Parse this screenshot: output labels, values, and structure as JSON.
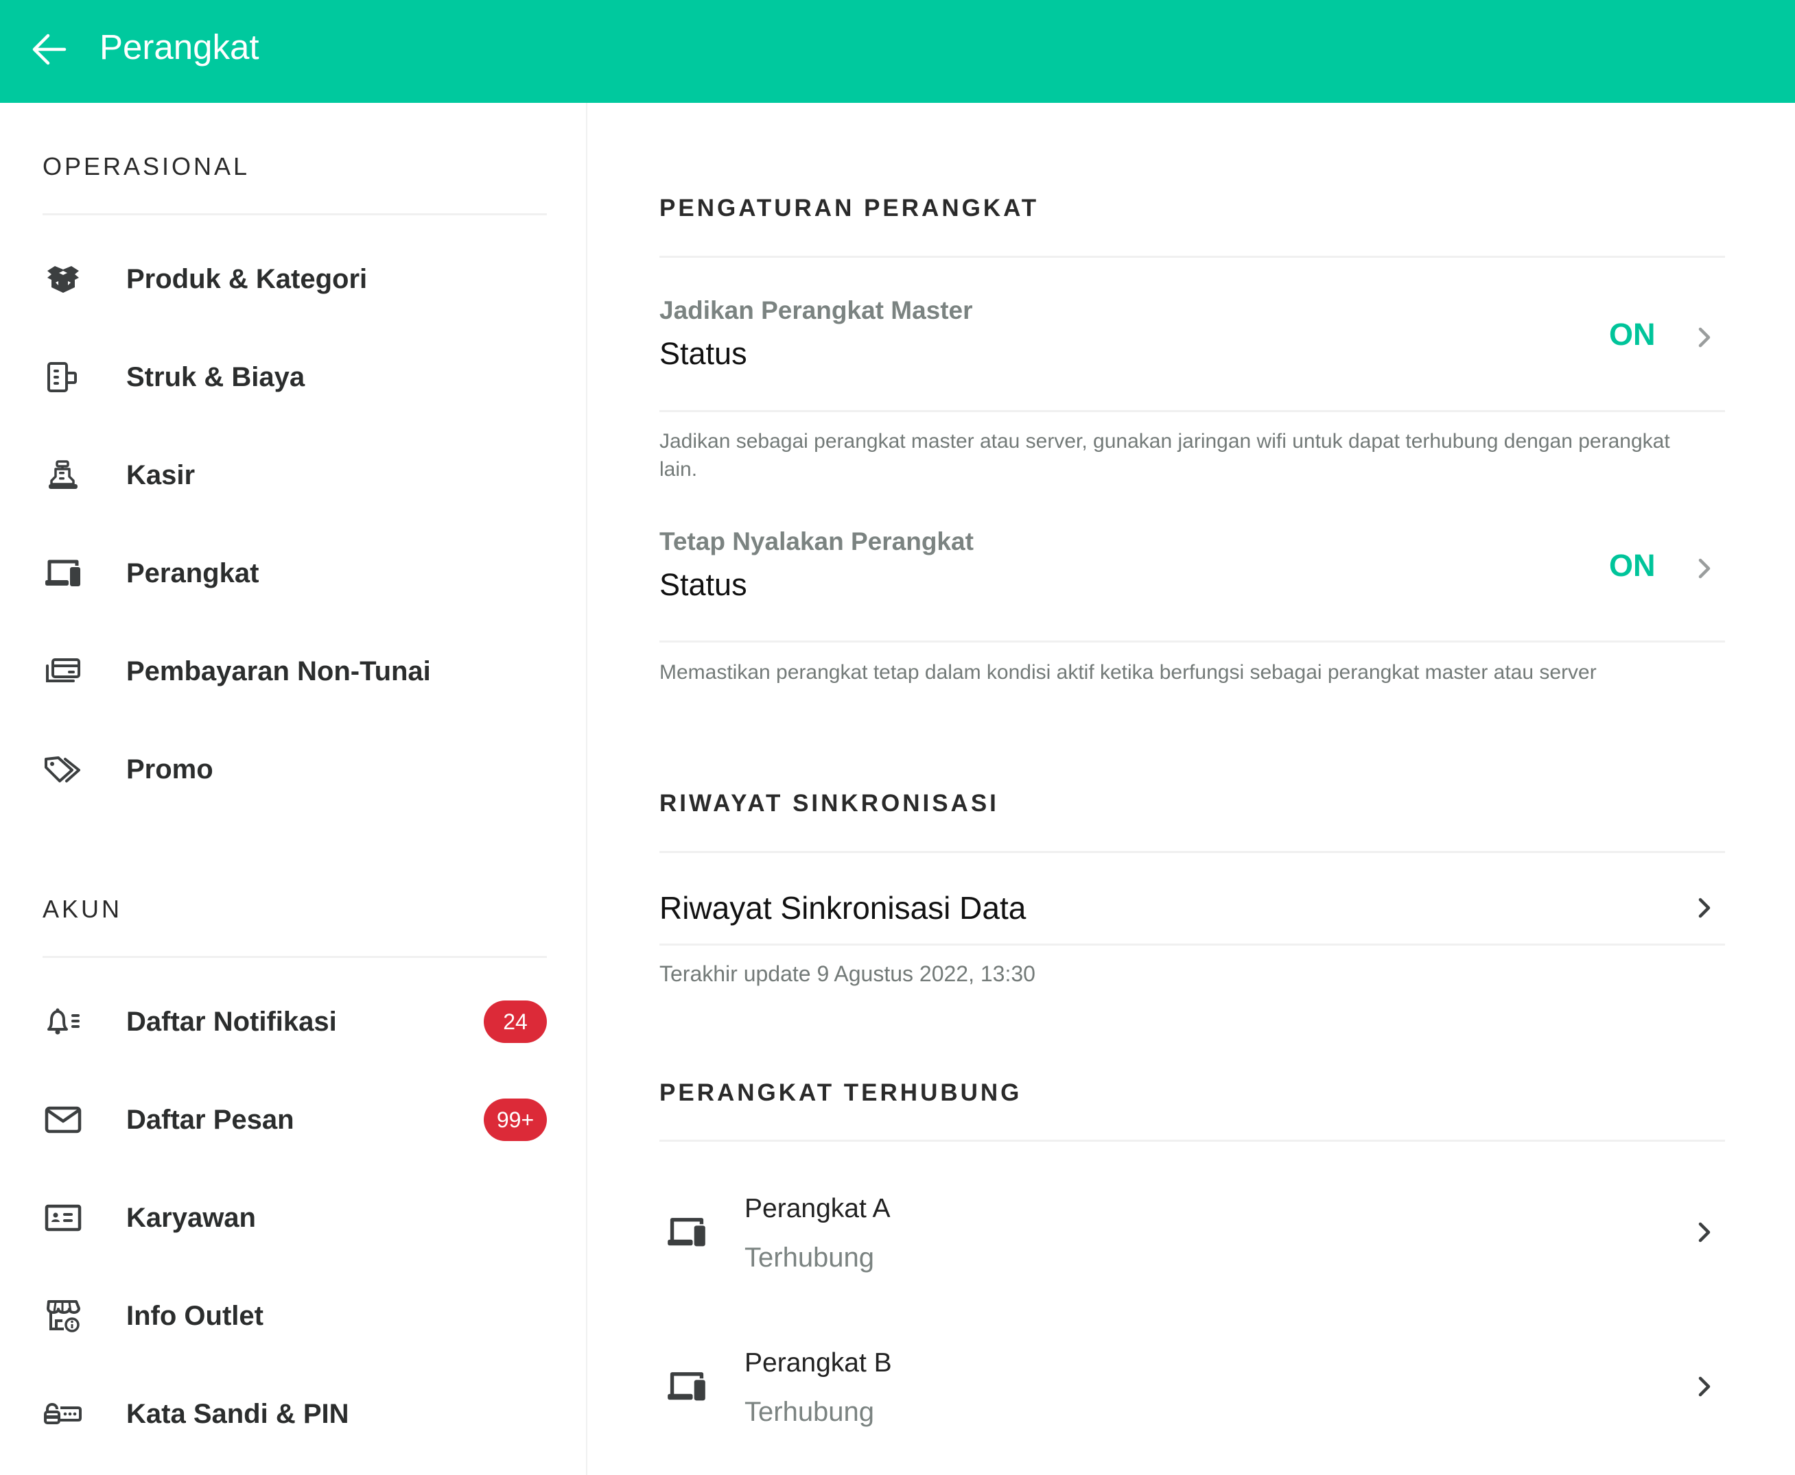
{
  "header": {
    "title": "Perangkat",
    "back_icon": "arrow-left-icon",
    "color": "#00C99E"
  },
  "sidebar": {
    "sections": [
      {
        "label": "OPERASIONAL",
        "items": [
          {
            "label": "Produk & Kategori",
            "icon": "box-icon"
          },
          {
            "label": "Struk & Biaya",
            "icon": "receipt-printer-icon"
          },
          {
            "label": "Kasir",
            "icon": "cash-register-icon"
          },
          {
            "label": "Perangkat",
            "icon": "devices-icon"
          },
          {
            "label": "Pembayaran Non-Tunai",
            "icon": "card-payment-icon"
          },
          {
            "label": "Promo",
            "icon": "tags-icon"
          }
        ]
      },
      {
        "label": "AKUN",
        "items": [
          {
            "label": "Daftar Notifikasi",
            "icon": "bell-list-icon",
            "badge": "24"
          },
          {
            "label": "Daftar Pesan",
            "icon": "mail-icon",
            "badge": "99+"
          },
          {
            "label": "Karyawan",
            "icon": "id-card-icon"
          },
          {
            "label": "Info Outlet",
            "icon": "store-info-icon"
          },
          {
            "label": "Kata Sandi & PIN",
            "icon": "password-icon"
          }
        ]
      }
    ],
    "badge_color": "#DC2A38"
  },
  "main": {
    "device_settings": {
      "title": "PENGATURAN PERANGKAT",
      "items": [
        {
          "label": "Jadikan Perangkat Master",
          "sub": "Status",
          "value": "ON",
          "description": "Jadikan sebagai perangkat master atau server, gunakan jaringan wifi untuk dapat terhubung dengan perangkat lain."
        },
        {
          "label": "Tetap Nyalakan Perangkat",
          "sub": "Status",
          "value": "ON",
          "description": "Memastikan perangkat tetap dalam kondisi aktif ketika berfungsi sebagai perangkat master atau server"
        }
      ],
      "on_color": "#00C49A"
    },
    "sync_history": {
      "title": "RIWAYAT SINKRONISASI",
      "row_label": "Riwayat Sinkronisasi Data",
      "last_update": "Terakhir update 9 Agustus 2022, 13:30"
    },
    "connected_devices": {
      "title": "PERANGKAT TERHUBUNG",
      "devices": [
        {
          "name": "Perangkat A",
          "status": "Terhubung",
          "icon": "devices-icon"
        },
        {
          "name": "Perangkat B",
          "status": "Terhubung",
          "icon": "devices-icon"
        }
      ]
    }
  }
}
